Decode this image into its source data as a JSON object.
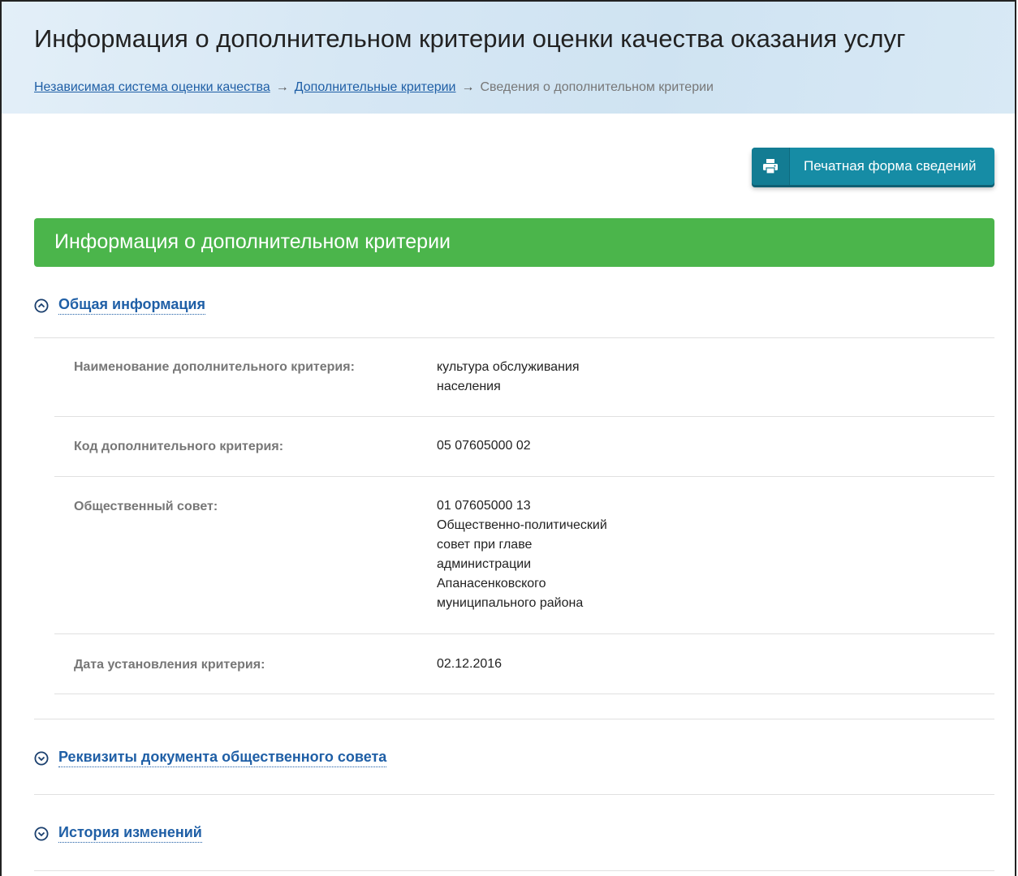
{
  "header": {
    "title": "Информация о дополнительном критерии оценки качества оказания услуг",
    "breadcrumb": [
      {
        "label": "Независимая система оценки качества",
        "link": true
      },
      {
        "label": "Дополнительные критерии",
        "link": true
      },
      {
        "label": "Сведения о дополнительном критерии",
        "link": false
      }
    ],
    "separator": "→"
  },
  "print_button": {
    "label": "Печатная форма сведений",
    "icon": "printer-icon"
  },
  "section_header": {
    "title": "Информация о дополнительном критерии"
  },
  "sections": {
    "general": {
      "title": "Общая информация",
      "state": "expanded",
      "rows": [
        {
          "label": "Наименование дополнительного критерия:",
          "value_lines": [
            "культура обслуживания",
            "населения"
          ]
        },
        {
          "label": "Код дополнительного критерия:",
          "value_lines": [
            "05 07605000 02"
          ]
        },
        {
          "label": "Общественный совет:",
          "value_lines": [
            "01 07605000 13",
            "Общественно-политический",
            "совет при главе",
            "администрации",
            "Апанасенковского",
            "муниципального района"
          ]
        },
        {
          "label": "Дата установления критерия:",
          "value_lines": [
            "02.12.2016"
          ]
        }
      ]
    },
    "council_doc": {
      "title": "Реквизиты документа общественного совета",
      "state": "collapsed"
    },
    "history": {
      "title": "История изменений",
      "state": "collapsed"
    }
  },
  "colors": {
    "header_bg": "#d6e7f4",
    "link": "#1f5fa6",
    "print_button": "#168ca5",
    "section_bar": "#4bb54b"
  }
}
